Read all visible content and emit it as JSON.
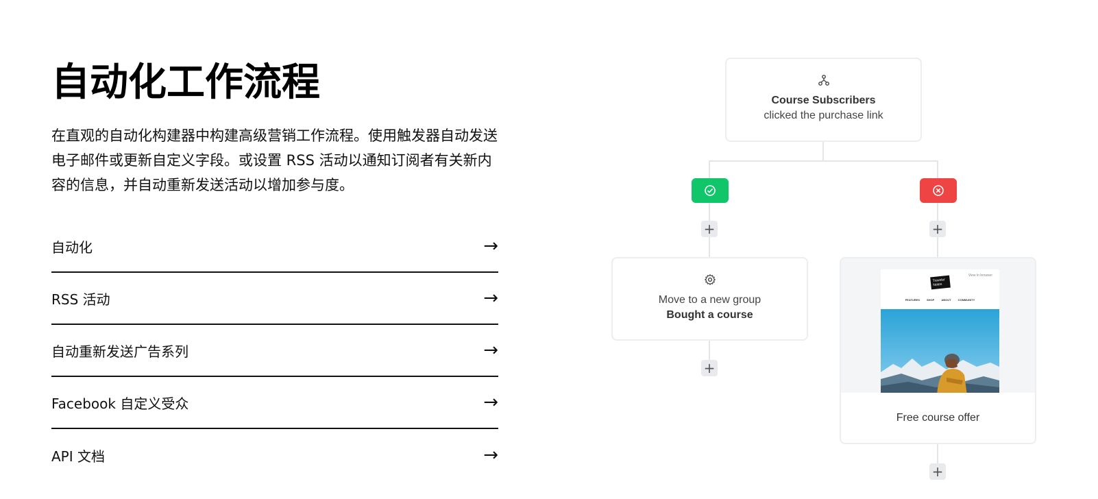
{
  "section": {
    "title": "自动化工作流程",
    "description": "在直观的自动化构建器中构建高级营销工作流程。使用触发器自动发送电子邮件或更新自定义字段。或设置 RSS 活动以通知订阅者有关新内容的信息，并自动重新发送活动以增加参与度。"
  },
  "links": [
    {
      "label": "自动化",
      "arrow": "→"
    },
    {
      "label": "RSS 活动",
      "arrow": "→"
    },
    {
      "label": "自动重新发送广告系列",
      "arrow": "→"
    },
    {
      "label": "Facebook 自定义受众",
      "arrow": "→"
    },
    {
      "label": "API 文档",
      "arrow": "→"
    }
  ],
  "workflow": {
    "trigger": {
      "icon": "split-icon",
      "strong": "Course Subscribers",
      "text": "clicked the purchase link"
    },
    "yes_badge": {
      "icon": "check-circle-icon",
      "color": "#11c56b"
    },
    "no_badge": {
      "icon": "x-circle-icon",
      "color": "#ef4444"
    },
    "action": {
      "icon": "gear-icon",
      "text": "Move to a new group",
      "strong": "Bought a course"
    },
    "email": {
      "top_link": "View in browser",
      "logo": "Traveler Notes",
      "nav": [
        "FEATURES",
        "SHOP",
        "ABOUT",
        "COMMUNITY"
      ],
      "caption": "Free course offer"
    },
    "plus_symbol": "+"
  }
}
